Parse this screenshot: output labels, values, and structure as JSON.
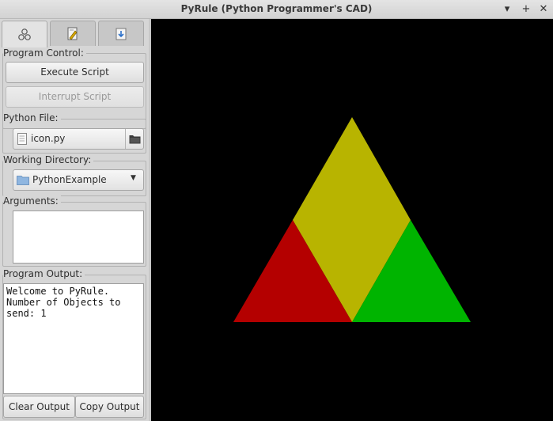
{
  "window": {
    "title": "PyRule (Python Programmer's CAD)",
    "minimize_icon": "minimize-icon",
    "maximize_icon": "maximize-icon",
    "close_icon": "close-icon"
  },
  "sidebar": {
    "tabs": [
      {
        "icon": "molecule-icon",
        "active": true
      },
      {
        "icon": "document-edit-icon",
        "active": false
      },
      {
        "icon": "download-icon",
        "active": false
      }
    ],
    "program_control": {
      "label": "Program Control:",
      "execute_label": "Execute Script",
      "interrupt_label": "Interrupt Script"
    },
    "python_file": {
      "label": "Python File:",
      "value": "icon.py",
      "file_icon": "file-icon",
      "browse_icon": "folder-icon"
    },
    "working_directory": {
      "label": "Working Directory:",
      "value": "PythonExample",
      "folder_icon": "folder-icon"
    },
    "arguments": {
      "label": "Arguments:",
      "value": ""
    },
    "program_output": {
      "label": "Program Output:",
      "text": "Welcome to PyRule.\nNumber of Objects to\nsend: 1",
      "clear_label": "Clear Output",
      "copy_label": "Copy Output"
    }
  },
  "viewport": {
    "background": "#000000",
    "shapes": [
      {
        "name": "yellow-rhombus",
        "color": "#b8b400"
      },
      {
        "name": "red-triangle",
        "color": "#b40000"
      },
      {
        "name": "green-triangle",
        "color": "#00b400"
      }
    ]
  }
}
